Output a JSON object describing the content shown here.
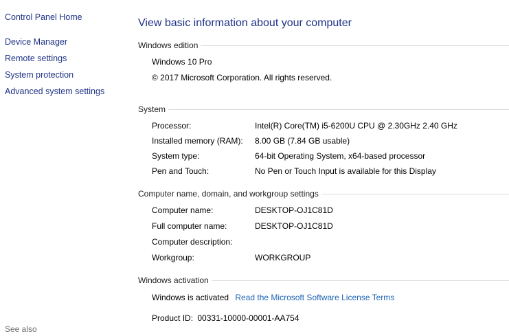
{
  "sidebar": {
    "home": "Control Panel Home",
    "items": [
      {
        "label": "Device Manager"
      },
      {
        "label": "Remote settings"
      },
      {
        "label": "System protection"
      },
      {
        "label": "Advanced system settings"
      }
    ],
    "see_also": "See also"
  },
  "main": {
    "title": "View basic information about your computer",
    "windows_edition": {
      "header": "Windows edition",
      "edition": "Windows 10 Pro",
      "copyright": "© 2017 Microsoft Corporation. All rights reserved."
    },
    "system": {
      "header": "System",
      "rows": [
        {
          "label": "Processor:",
          "value": "Intel(R) Core(TM) i5-6200U CPU @ 2.30GHz   2.40 GHz"
        },
        {
          "label": "Installed memory (RAM):",
          "value": "8.00 GB (7.84 GB usable)"
        },
        {
          "label": "System type:",
          "value": "64-bit Operating System, x64-based processor"
        },
        {
          "label": "Pen and Touch:",
          "value": "No Pen or Touch Input is available for this Display"
        }
      ]
    },
    "computer_name": {
      "header": "Computer name, domain, and workgroup settings",
      "rows": [
        {
          "label": "Computer name:",
          "value": "DESKTOP-OJ1C81D"
        },
        {
          "label": "Full computer name:",
          "value": "DESKTOP-OJ1C81D"
        },
        {
          "label": "Computer description:",
          "value": ""
        },
        {
          "label": "Workgroup:",
          "value": "WORKGROUP"
        }
      ]
    },
    "activation": {
      "header": "Windows activation",
      "status": "Windows is activated",
      "license_link": "Read the Microsoft Software License Terms",
      "product_id_label": "Product ID:",
      "product_id": "00331-10000-00001-AA754"
    }
  },
  "colors": {
    "link": "#1e3287",
    "accent_link": "#1e64b4",
    "separator": "#d9d9d9",
    "muted": "#6d6d6d"
  }
}
